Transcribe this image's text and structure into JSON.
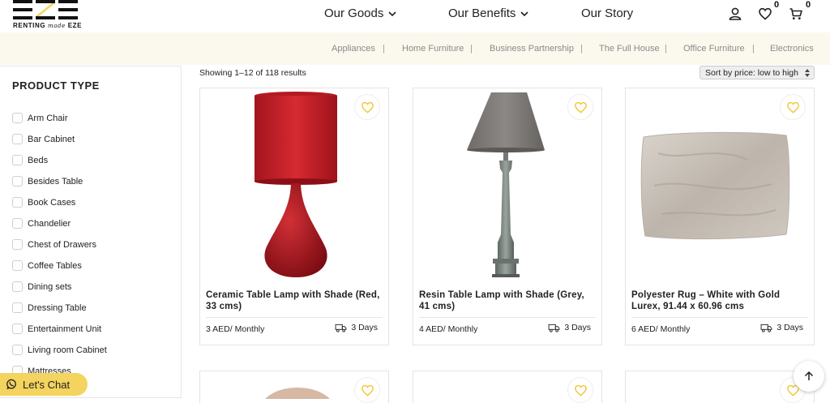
{
  "brand": {
    "logo_text_left": "RENTING",
    "logo_text_mid": "made",
    "logo_text_right": "EZE",
    "accent": "#f4d35e"
  },
  "nav": {
    "goods": "Our Goods",
    "benefits": "Our Benefits",
    "story": "Our Story",
    "wishlist_count": "0",
    "cart_count": "0"
  },
  "categories": [
    "Appliances",
    "Home Furniture",
    "Business Partnership",
    "The Full House",
    "Office Furniture",
    "Electronics"
  ],
  "separator": "|",
  "sidebar": {
    "title": "PRODUCT TYPE",
    "options": [
      "Arm Chair",
      "Bar Cabinet",
      "Beds",
      "Besides Table",
      "Book Cases",
      "Chandelier",
      "Chest of Drawers",
      "Coffee Tables",
      "Dining sets",
      "Dressing Table",
      "Entertainment Unit",
      "Living room Cabinet",
      "Mattresses"
    ]
  },
  "chat_label": "Let's Chat",
  "results_text": "Showing 1–12 of 118 results",
  "sort": {
    "selected": "Sort by price: low to high"
  },
  "products": [
    {
      "title": "Ceramic Table Lamp with Shade (Red, 33 cms)",
      "price": "3 AED/ Monthly",
      "delivery": "3 Days"
    },
    {
      "title": "Resin Table Lamp with Shade (Grey, 41 cms)",
      "price": "4 AED/ Monthly",
      "delivery": "3 Days"
    },
    {
      "title": "Polyester Rug – White with Gold Lurex, 91.44 x 60.96 cms",
      "price": "6 AED/ Monthly",
      "delivery": "3 Days"
    }
  ],
  "icons": {
    "user": "user-icon",
    "heart": "heart-icon",
    "cart": "cart-icon",
    "chevron": "chevron-down-icon",
    "truck": "truck-icon",
    "whatsapp": "whatsapp-icon",
    "arrow_up": "arrow-up-icon"
  }
}
